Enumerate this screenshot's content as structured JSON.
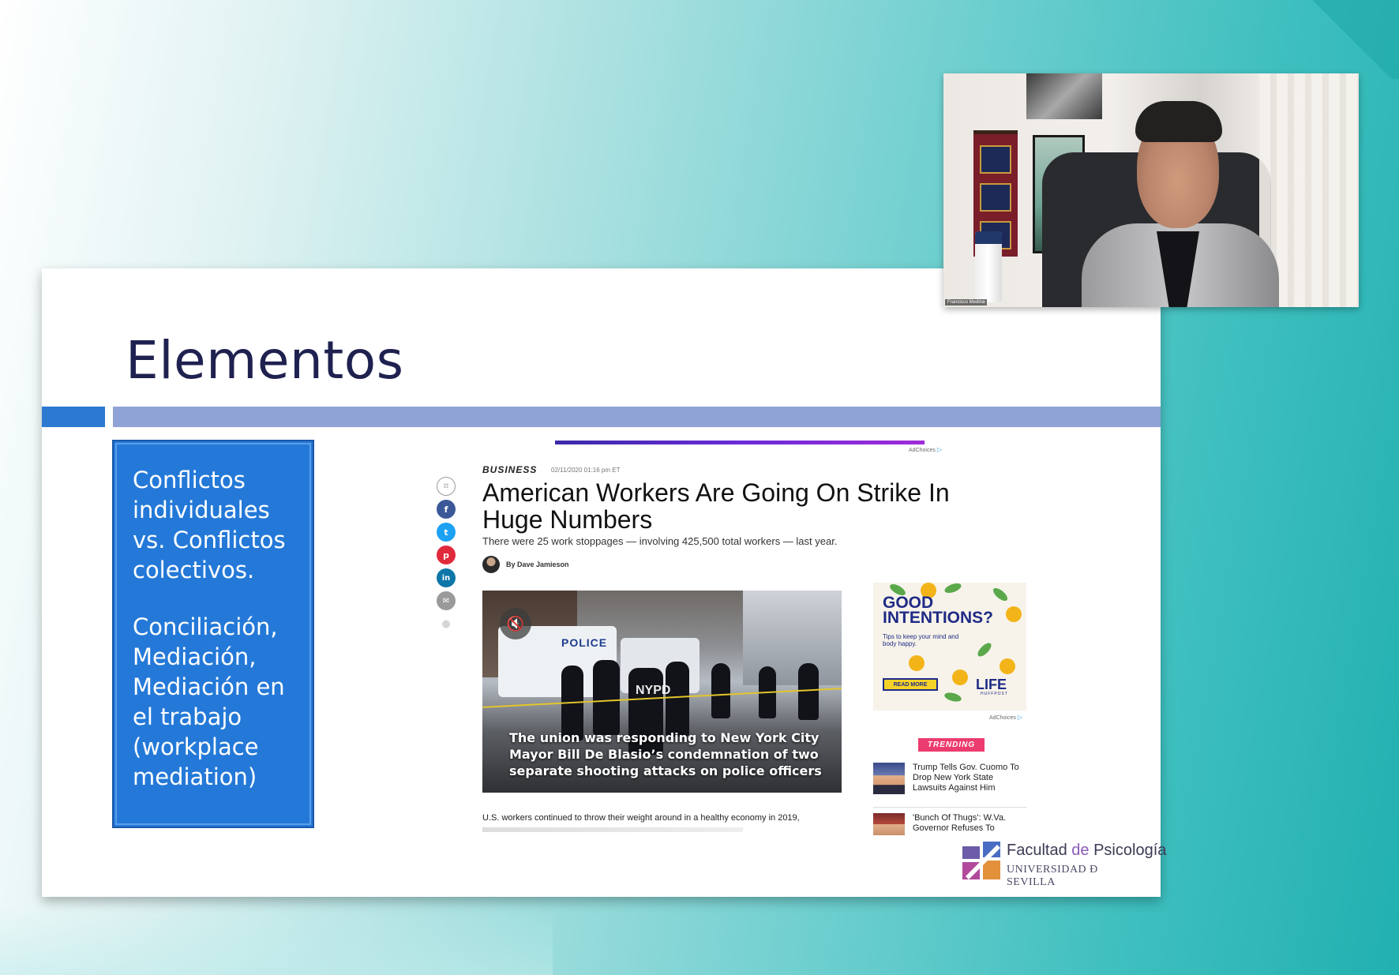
{
  "slide": {
    "title": "Elementos",
    "box_paragraphs": [
      "Conflictos individuales vs. Conflictos colectivos.",
      "Conciliación, Mediación, Mediación en el trabajo (workplace mediation)"
    ]
  },
  "article": {
    "ad_choices": "AdChoices",
    "category": "BUSINESS",
    "timestamp": "02/11/2020 01:16 pm ET",
    "headline": "American Workers Are Going On Strike In Huge Numbers",
    "subhead": "There were 25 work stoppages — involving 425,500 total workers — last year.",
    "byline": "By Dave Jamieson",
    "share_buttons": [
      {
        "icon": "bookmark-icon",
        "glyph": "⌑",
        "color": "#ffffff"
      },
      {
        "icon": "facebook-icon",
        "glyph": "f",
        "color": "#3b5998"
      },
      {
        "icon": "twitter-icon",
        "glyph": "t",
        "color": "#1da1f2"
      },
      {
        "icon": "pinterest-icon",
        "glyph": "p",
        "color": "#e1293c"
      },
      {
        "icon": "linkedin-icon",
        "glyph": "in",
        "color": "#0e76a8"
      },
      {
        "icon": "email-icon",
        "glyph": "✉",
        "color": "#9a9a9a"
      },
      {
        "icon": "comment-icon",
        "glyph": "●",
        "color": "#d6d6d6"
      }
    ],
    "photo": {
      "police_text": "POLICE",
      "nypd_text": "NYPD",
      "caption": "The union was responding to New York City Mayor Bill De Blasio’s condemnation of two separate shooting attacks on police officers"
    },
    "body_first_line": "U.S. workers continued to throw their weight around in a healthy economy in 2019,",
    "ad": {
      "title": "GOOD INTENTIONS?",
      "tagline": "Tips to keep your mind and body happy.",
      "button": "READ MORE",
      "brand": "LIFE",
      "brand_sub": "HUFFPOST"
    },
    "trending_label": "TRENDING",
    "trending": [
      "Trump Tells Gov. Cuomo To Drop New York State Lawsuits Against Him",
      "'Bunch Of Thugs': W.Va. Governor Refuses To"
    ]
  },
  "logo": {
    "name_part1": "Facultad",
    "name_de": "de",
    "name_part2": "Psicología",
    "university": "UNIVERSIDAD Ð SEVILLA"
  },
  "webcam": {
    "participant_name": "Francisco Medina"
  },
  "colors": {
    "slide_title": "#1f2150",
    "blue_box": "#2479d8",
    "accent_bar": "#8fa3d6",
    "trending": "#ec3b6f"
  }
}
